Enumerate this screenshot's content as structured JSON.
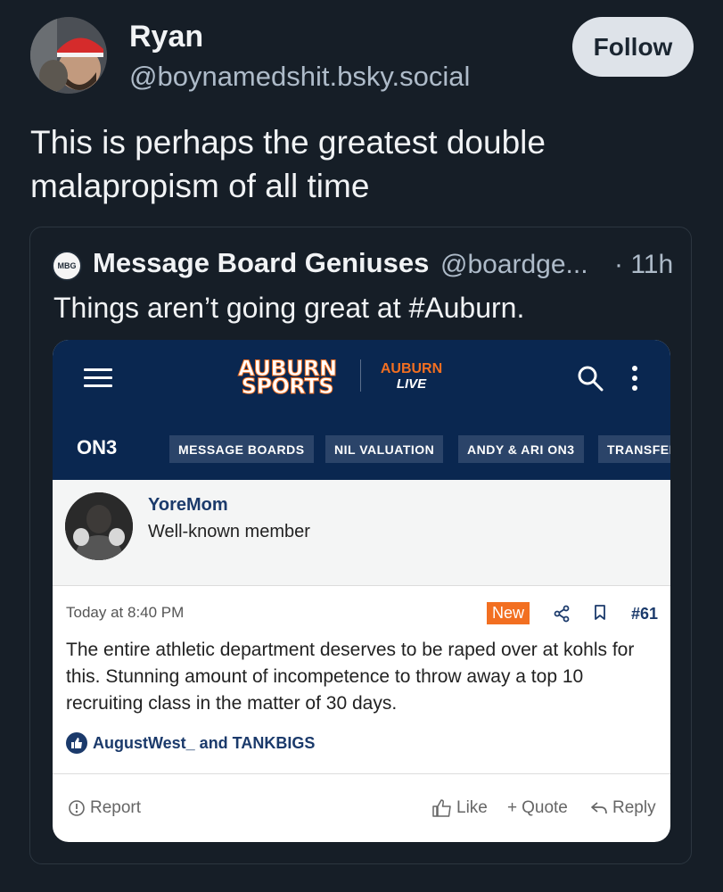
{
  "profile": {
    "name": "Ryan",
    "handle": "@boynamedshit.bsky.social",
    "follow_label": "Follow"
  },
  "post": {
    "text": "This is perhaps the greatest double malapropism of all time"
  },
  "quote": {
    "avatar_text": "MBG",
    "name": "Message Board Geniuses",
    "handle": "@boardge...",
    "time": "· 11h",
    "text": "Things aren’t going great at #Auburn."
  },
  "screenshot": {
    "logo_main_1": "AUBURN",
    "logo_main_2": "SPORTS",
    "logo_live_1": "AUBURN",
    "logo_live_2": "LIVE",
    "on3": "ON3",
    "nav": [
      "MESSAGE BOARDS",
      "NIL VALUATION",
      "ANDY & ARI ON3",
      "TRANSFEI"
    ],
    "user_name": "YoreMom",
    "user_role": "Well-known member",
    "date": "Today at 8:40 PM",
    "badge": "New",
    "post_number": "#61",
    "body": "The entire athletic department deserves to be raped over at kohls for this. Stunning amount of incompetence to throw away a top 10 recruiting class in the matter of 30 days.",
    "likes": "AugustWest_ and TANKBIGS",
    "actions": {
      "report": "Report",
      "like": "Like",
      "quote": "Quote",
      "reply": "Reply"
    }
  },
  "colors": {
    "background": "#161e27",
    "header_navy": "#0a2750",
    "accent_orange": "#f26f21",
    "follow_bg": "#dee3e9"
  }
}
